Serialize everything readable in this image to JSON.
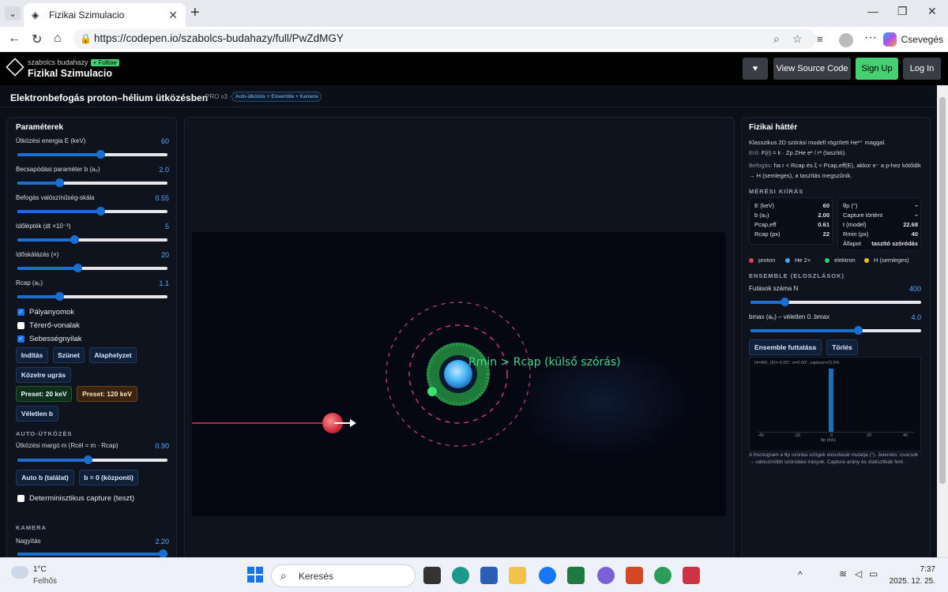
{
  "browser": {
    "tab_title": "Fizikai Szimulacio",
    "url": "https://codepen.io/szabolcs-budahazy/full/PwZdMGY",
    "copilot_label": "Csevegés"
  },
  "codepen": {
    "author": "szabolcs budahazy",
    "follow": "+ Follow",
    "pen_title": "Fizikal Szimulacio",
    "heart": "♥",
    "view_source": "View Source Code",
    "signup": "Sign Up",
    "login": "Log In"
  },
  "app": {
    "title": "Elektronbefogás proton–hélium ütközésben",
    "version": "PRO v3 ·",
    "badge": "Auto-ütközés + Ensemble + Kamera"
  },
  "params": {
    "title": "Paraméterek",
    "sliders": [
      {
        "label": "Ütközési energia E (keV)",
        "value": "60",
        "pos": 0.55
      },
      {
        "label": "Becsapódási paraméter b (a₀)",
        "value": "2.0",
        "pos": 0.28
      },
      {
        "label": "Befogás valószínűség-skála",
        "value": "0.55",
        "pos": 0.55
      },
      {
        "label": "Időlépték (dt ×10⁻³)",
        "value": "5",
        "pos": 0.38
      },
      {
        "label": "Időskálázás (×)",
        "value": "20",
        "pos": 0.4
      },
      {
        "label": "Rcap (a₀)",
        "value": "1.1",
        "pos": 0.28
      }
    ],
    "checks": [
      {
        "label": "Pályanyomok",
        "on": true
      },
      {
        "label": "Térerő-vonalak",
        "on": false
      },
      {
        "label": "Sebességnyilak",
        "on": true
      }
    ],
    "btn_start": "Indítás",
    "btn_pause": "Szünet",
    "btn_reset": "Alaphelyzet",
    "btn_jump": "Közelre ugrás",
    "btn_preset20": "Preset: 20 keV",
    "btn_preset120": "Preset: 120 keV",
    "btn_random_b": "Véletlen b",
    "auto_title": "AUTO-ÜTKÖZÉS",
    "margin_label": "Ütközési margó m (Rcél = m · Rcap)",
    "margin_value": "0.90",
    "margin_pos": 0.47,
    "btn_auto_b": "Auto b (találat)",
    "btn_b0": "b = 0 (központi)",
    "det_capture": "Determinisztikus capture (teszt)",
    "camera_title": "KAMERA",
    "zoom_label": "Nagyítás",
    "zoom_value": "2.20",
    "zoom_pos": 0.97
  },
  "canvas": {
    "annotation": "Rmin > Rcap (külső szórás)"
  },
  "physics": {
    "title": "Fizikai háttér",
    "line1": "Klasszikus 2D szórási modell rögzített He²⁺ maggal.",
    "line2_label": "Erő:",
    "line2": "F(r) = k · Zp ZHe e² / r² (taszító).",
    "line3_label": "Befogás:",
    "line3": "ha r < Rcap és ξ < Pcap,eff(E), akkor e⁻ a p-hez kötődik → H (semleges), a taszítás megszűnik.",
    "meas_title": "MÉRÉSI KIÍRÁS",
    "meas_left": [
      [
        "E (keV)",
        "60"
      ],
      [
        "b (a₀)",
        "2.00"
      ],
      [
        "Pcap,eff",
        "0.61"
      ],
      [
        "Rcap (px)",
        "22"
      ]
    ],
    "meas_right": [
      [
        "θp (°)",
        "–"
      ],
      [
        "Capture történt",
        "–"
      ],
      [
        "t (model)",
        "22.68"
      ],
      [
        "Rmin (px)",
        "40"
      ]
    ],
    "state_label": "Állapot",
    "state_value": "taszító szóródás",
    "legend": [
      {
        "label": "proton",
        "color": "#e0404a"
      },
      {
        "label": "He 2+",
        "color": "#3fa9f5"
      },
      {
        "label": "elektron",
        "color": "#2fcf6a"
      },
      {
        "label": "H (semleges)",
        "color": "#f0c020"
      }
    ],
    "ens_title": "ENSEMBLE (ELOSZLÁSOK)",
    "n_label": "Futások száma N",
    "n_value": "400",
    "n_pos": 0.2,
    "bmax_label": "bmax (a₀) – véletlen 0..bmax",
    "bmax_value": "4.0",
    "bmax_pos": 0.63,
    "btn_run": "Ensemble futtatása",
    "btn_clear": "Törlés",
    "hist_header": "N=400, ⟨θ⟩=-0.00°, σ=0.00°, capture=23.3%",
    "hist_ticks": [
      "-40",
      "-20",
      "0",
      "20",
      "40"
    ],
    "hist_xlabel": "θp (fok)",
    "note": "A hisztogram a θp szórási szögek eloszlását mutatja (°). Jelentés: csúcsok → valószínűbb szóródási irányok. Capture arány és statisztikák fent."
  },
  "taskbar": {
    "temp": "1°C",
    "weather": "Felhős",
    "search": "Keresés",
    "time": "7:37",
    "date": "2025. 12. 25."
  }
}
